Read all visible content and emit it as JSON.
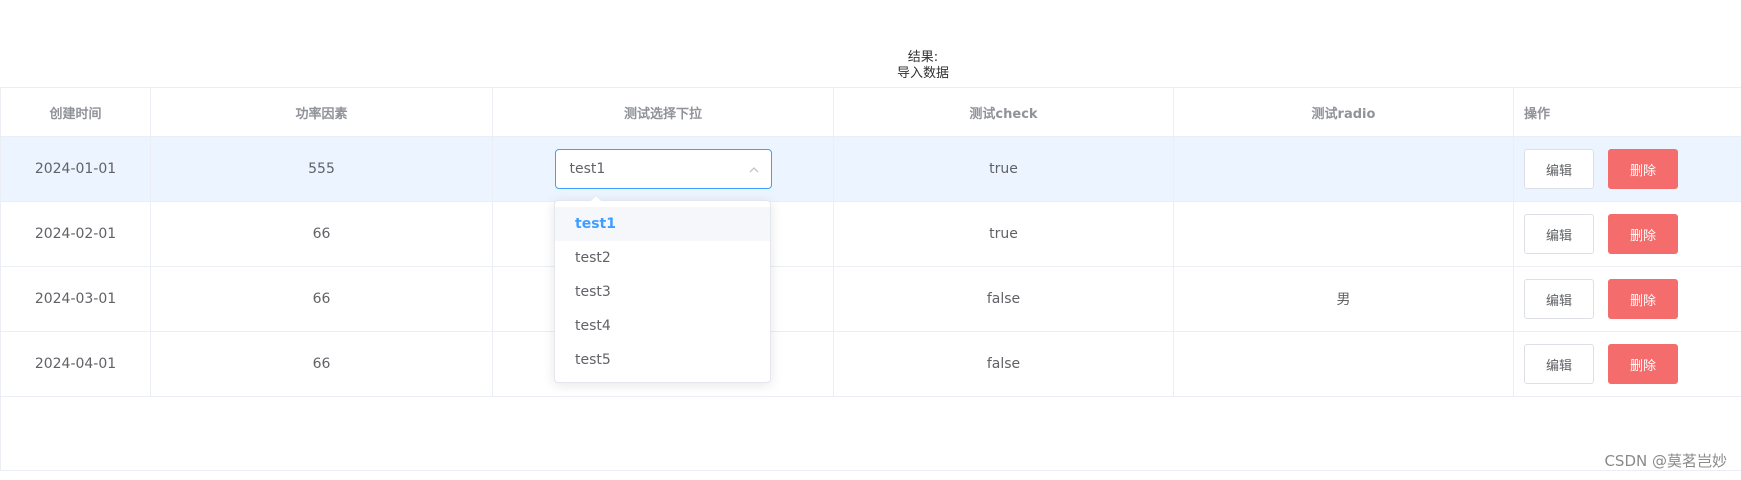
{
  "result": {
    "label": "结果:",
    "value": "导入数据"
  },
  "table": {
    "headers": [
      "创建时间",
      "功率因素",
      "测试选择下拉",
      "测试check",
      "测试radio",
      "操作"
    ],
    "rows": [
      {
        "date": "2024-01-01",
        "power": "555",
        "select": "test1",
        "check": "true",
        "radio": ""
      },
      {
        "date": "2024-02-01",
        "power": "66",
        "select": "",
        "check": "true",
        "radio": ""
      },
      {
        "date": "2024-03-01",
        "power": "66",
        "select": "",
        "check": "false",
        "radio": "男"
      },
      {
        "date": "2024-04-01",
        "power": "66",
        "select": "",
        "check": "false",
        "radio": ""
      }
    ],
    "edit_label": "编辑",
    "delete_label": "删除"
  },
  "dropdown": {
    "options": [
      "test1",
      "test2",
      "test3",
      "test4",
      "test5"
    ],
    "selected": "test1"
  },
  "colors": {
    "primary": "#409eff",
    "danger": "#f56c6c",
    "row_highlight": "#ecf5ff"
  },
  "watermark": "CSDN @莫茗岂妙"
}
